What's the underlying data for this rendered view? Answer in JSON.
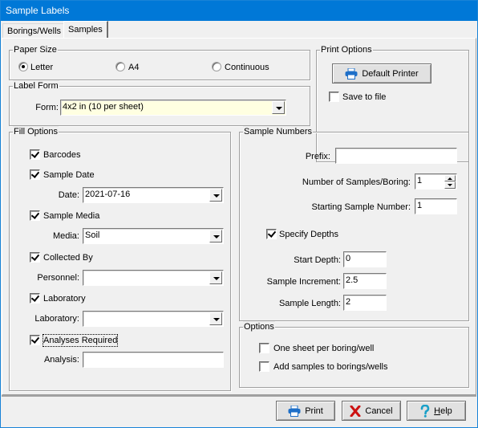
{
  "window": {
    "title": "Sample Labels"
  },
  "tabs": [
    {
      "label": "Borings/Wells",
      "active": false
    },
    {
      "label": "Samples",
      "active": true
    }
  ],
  "paper_size": {
    "title": "Paper Size",
    "options": [
      {
        "label": "Letter",
        "selected": true
      },
      {
        "label": "A4",
        "selected": false
      },
      {
        "label": "Continuous",
        "selected": false
      }
    ]
  },
  "print_options": {
    "title": "Print Options",
    "printer_button": "Default Printer",
    "save_to_file": {
      "label": "Save to file",
      "checked": false
    }
  },
  "label_form": {
    "title": "Label Form",
    "form_label": "Form:",
    "form_value": "4x2 in (10 per sheet)",
    "form_bg": "#ffffe1"
  },
  "fill_options": {
    "title": "Fill Options",
    "barcodes": {
      "label": "Barcodes",
      "checked": true
    },
    "sample_date": {
      "label": "Sample Date",
      "checked": true
    },
    "date_label": "Date:",
    "date_value": "2021-07-16",
    "sample_media": {
      "label": "Sample Media",
      "checked": true
    },
    "media_label": "Media:",
    "media_value": "Soil",
    "collected_by": {
      "label": "Collected By",
      "checked": true
    },
    "personnel_label": "Personnel:",
    "personnel_value": "",
    "laboratory": {
      "label": "Laboratory",
      "checked": true
    },
    "laboratory_label": "Laboratory:",
    "laboratory_value": "",
    "analyses_required": {
      "label": "Analyses Required",
      "checked": true
    },
    "analysis_label": "Analysis:",
    "analysis_value": ""
  },
  "sample_numbers": {
    "title": "Sample Numbers",
    "prefix_label": "Prefix:",
    "prefix_value": "",
    "num_samples_label": "Number of Samples/Boring:",
    "num_samples_value": "1",
    "starting_number_label": "Starting Sample Number:",
    "starting_number_value": "1",
    "specify_depths": {
      "label": "Specify Depths",
      "checked": true
    },
    "start_depth_label": "Start Depth:",
    "start_depth_value": "0",
    "increment_label": "Sample Increment:",
    "increment_value": "2.5",
    "length_label": "Sample Length:",
    "length_value": "2"
  },
  "options": {
    "title": "Options",
    "one_sheet": {
      "label": "One sheet per boring/well",
      "checked": false
    },
    "add_samples": {
      "label": "Add samples to borings/wells",
      "checked": false
    }
  },
  "buttons": {
    "print": "Print",
    "cancel": "Cancel",
    "help_accel": "H",
    "help_rest": "elp"
  },
  "icons": {
    "printer": "printer-icon",
    "cancel": "x-icon",
    "help": "question-mark-icon"
  },
  "colors": {
    "titlebar": "#0078d7",
    "printer_icon": "#1e6fc8",
    "cancel_icon": "#cc1111",
    "help_icon": "#1aa0c8"
  }
}
